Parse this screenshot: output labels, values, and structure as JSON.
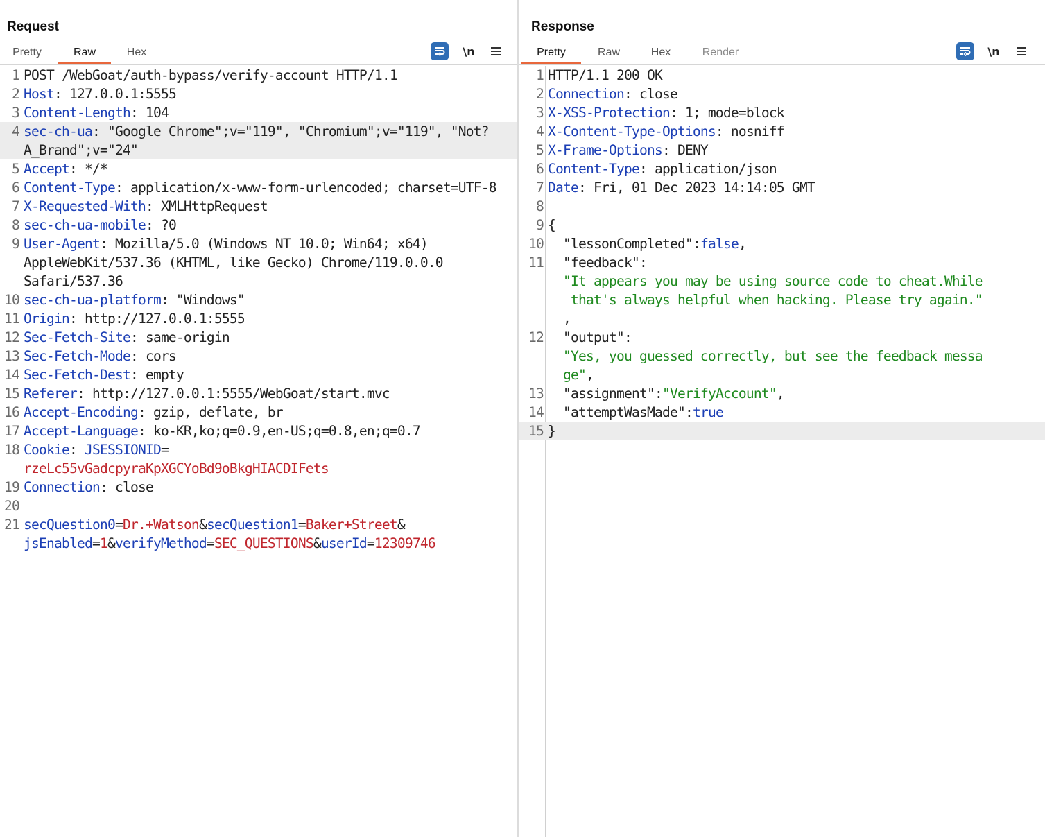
{
  "request": {
    "title": "Request",
    "tabs": [
      {
        "label": "Pretty",
        "active": false
      },
      {
        "label": "Raw",
        "active": true
      },
      {
        "label": "Hex",
        "active": false
      }
    ],
    "toolbar": {
      "wrap_icon": "text-wrap-icon",
      "newline_label": "\\n",
      "menu_icon": "hamburger-menu-icon"
    },
    "lines": [
      {
        "n": "1",
        "parts": [
          {
            "t": "POST /WebGoat/auth-bypass/verify-account HTTP/1.1",
            "c": "pl"
          }
        ]
      },
      {
        "n": "2",
        "parts": [
          {
            "t": "Host",
            "c": "hk"
          },
          {
            "t": ": 127.0.0.1:5555",
            "c": "hv"
          }
        ]
      },
      {
        "n": "3",
        "parts": [
          {
            "t": "Content-Length",
            "c": "hk"
          },
          {
            "t": ": 104",
            "c": "hv"
          }
        ]
      },
      {
        "n": "4",
        "highlight": true,
        "parts": [
          {
            "t": "sec-ch-ua",
            "c": "hk"
          },
          {
            "t": ": \"Google Chrome\";v=\"119\", \"Chromium\";v=\"119\", \"Not?A_Brand\";v=\"24\"",
            "c": "hv"
          }
        ]
      },
      {
        "n": "5",
        "parts": [
          {
            "t": "Accept",
            "c": "hk"
          },
          {
            "t": ": */*",
            "c": "hv"
          }
        ]
      },
      {
        "n": "6",
        "parts": [
          {
            "t": "Content-Type",
            "c": "hk"
          },
          {
            "t": ": application/x-www-form-urlencoded; charset=UTF-8",
            "c": "hv"
          }
        ]
      },
      {
        "n": "7",
        "parts": [
          {
            "t": "X-Requested-With",
            "c": "hk"
          },
          {
            "t": ": XMLHttpRequest",
            "c": "hv"
          }
        ]
      },
      {
        "n": "8",
        "parts": [
          {
            "t": "sec-ch-ua-mobile",
            "c": "hk"
          },
          {
            "t": ": ?0",
            "c": "hv"
          }
        ]
      },
      {
        "n": "9",
        "parts": [
          {
            "t": "User-Agent",
            "c": "hk"
          },
          {
            "t": ": Mozilla/5.0 (Windows NT 10.0; Win64; x64) AppleWebKit/537.36 (KHTML, like Gecko) Chrome/119.0.0.0 Safari/537.36",
            "c": "hv"
          }
        ]
      },
      {
        "n": "10",
        "parts": [
          {
            "t": "sec-ch-ua-platform",
            "c": "hk"
          },
          {
            "t": ": \"Windows\"",
            "c": "hv"
          }
        ]
      },
      {
        "n": "11",
        "parts": [
          {
            "t": "Origin",
            "c": "hk"
          },
          {
            "t": ": http://127.0.0.1:5555",
            "c": "hv"
          }
        ]
      },
      {
        "n": "12",
        "parts": [
          {
            "t": "Sec-Fetch-Site",
            "c": "hk"
          },
          {
            "t": ": same-origin",
            "c": "hv"
          }
        ]
      },
      {
        "n": "13",
        "parts": [
          {
            "t": "Sec-Fetch-Mode",
            "c": "hk"
          },
          {
            "t": ": cors",
            "c": "hv"
          }
        ]
      },
      {
        "n": "14",
        "parts": [
          {
            "t": "Sec-Fetch-Dest",
            "c": "hk"
          },
          {
            "t": ": empty",
            "c": "hv"
          }
        ]
      },
      {
        "n": "15",
        "parts": [
          {
            "t": "Referer",
            "c": "hk"
          },
          {
            "t": ": http://127.0.0.1:5555/WebGoat/start.mvc",
            "c": "hv"
          }
        ]
      },
      {
        "n": "16",
        "parts": [
          {
            "t": "Accept-Encoding",
            "c": "hk"
          },
          {
            "t": ": gzip, deflate, br",
            "c": "hv"
          }
        ]
      },
      {
        "n": "17",
        "parts": [
          {
            "t": "Accept-Language",
            "c": "hk"
          },
          {
            "t": ": ko-KR,ko;q=0.9,en-US;q=0.8,en;q=0.7",
            "c": "hv"
          }
        ]
      },
      {
        "n": "18",
        "parts": [
          {
            "t": "Cookie",
            "c": "hk"
          },
          {
            "t": ": ",
            "c": "hv"
          },
          {
            "t": "JSESSIONID",
            "c": "ck"
          },
          {
            "t": "=\n",
            "c": "hv"
          },
          {
            "t": "rzeLc55vGadcpyraKpXGCYoBd9oBkgHIACDIFets",
            "c": "cv"
          }
        ]
      },
      {
        "n": "19",
        "parts": [
          {
            "t": "Connection",
            "c": "hk"
          },
          {
            "t": ": close",
            "c": "hv"
          }
        ]
      },
      {
        "n": "20",
        "parts": [
          {
            "t": "",
            "c": "pl"
          }
        ]
      },
      {
        "n": "21",
        "parts": [
          {
            "t": "secQuestion0",
            "c": "pk"
          },
          {
            "t": "=",
            "c": "pl"
          },
          {
            "t": "Dr.+Watson",
            "c": "pv"
          },
          {
            "t": "&",
            "c": "pl"
          },
          {
            "t": "secQuestion1",
            "c": "pk"
          },
          {
            "t": "=",
            "c": "pl"
          },
          {
            "t": "Baker+Street",
            "c": "pv"
          },
          {
            "t": "&\n",
            "c": "pl"
          },
          {
            "t": "jsEnabled",
            "c": "pk"
          },
          {
            "t": "=",
            "c": "pl"
          },
          {
            "t": "1",
            "c": "pv"
          },
          {
            "t": "&",
            "c": "pl"
          },
          {
            "t": "verifyMethod",
            "c": "pk"
          },
          {
            "t": "=",
            "c": "pl"
          },
          {
            "t": "SEC_QUESTIONS",
            "c": "pv"
          },
          {
            "t": "&",
            "c": "pl"
          },
          {
            "t": "userId",
            "c": "pk"
          },
          {
            "t": "=",
            "c": "pl"
          },
          {
            "t": "12309746",
            "c": "pv"
          }
        ]
      }
    ]
  },
  "response": {
    "title": "Response",
    "tabs": [
      {
        "label": "Pretty",
        "active": true
      },
      {
        "label": "Raw",
        "active": false
      },
      {
        "label": "Hex",
        "active": false
      },
      {
        "label": "Render",
        "active": false,
        "disabled": true
      }
    ],
    "toolbar": {
      "wrap_icon": "text-wrap-icon",
      "newline_label": "\\n",
      "menu_icon": "hamburger-menu-icon"
    },
    "lines": [
      {
        "n": "1",
        "parts": [
          {
            "t": "HTTP/1.1 200 OK",
            "c": "pl"
          }
        ]
      },
      {
        "n": "2",
        "parts": [
          {
            "t": "Connection",
            "c": "hk"
          },
          {
            "t": ": close",
            "c": "hv"
          }
        ]
      },
      {
        "n": "3",
        "parts": [
          {
            "t": "X-XSS-Protection",
            "c": "hk"
          },
          {
            "t": ": 1; mode=block",
            "c": "hv"
          }
        ]
      },
      {
        "n": "4",
        "parts": [
          {
            "t": "X-Content-Type-Options",
            "c": "hk"
          },
          {
            "t": ": nosniff",
            "c": "hv"
          }
        ]
      },
      {
        "n": "5",
        "parts": [
          {
            "t": "X-Frame-Options",
            "c": "hk"
          },
          {
            "t": ": DENY",
            "c": "hv"
          }
        ]
      },
      {
        "n": "6",
        "parts": [
          {
            "t": "Content-Type",
            "c": "hk"
          },
          {
            "t": ": application/json",
            "c": "hv"
          }
        ]
      },
      {
        "n": "7",
        "parts": [
          {
            "t": "Date",
            "c": "hk"
          },
          {
            "t": ": Fri, 01 Dec 2023 14:14:05 GMT",
            "c": "hv"
          }
        ]
      },
      {
        "n": "8",
        "parts": [
          {
            "t": "",
            "c": "pl"
          }
        ]
      },
      {
        "n": "9",
        "parts": [
          {
            "t": "{",
            "c": "pl"
          }
        ]
      },
      {
        "n": "10",
        "parts": [
          {
            "t": "  \"lessonCompleted\"",
            "c": "jk"
          },
          {
            "t": ":",
            "c": "pl"
          },
          {
            "t": "false",
            "c": "jv"
          },
          {
            "t": ",",
            "c": "pl"
          }
        ]
      },
      {
        "n": "11",
        "parts": [
          {
            "t": "  \"feedback\"",
            "c": "jk"
          },
          {
            "t": ":\n  ",
            "c": "pl"
          },
          {
            "t": "\"It appears you may be using source code to cheat.While\n   that's always helpful when hacking. Please try again.\"",
            "c": "js"
          },
          {
            "t": "\n  ,",
            "c": "pl"
          }
        ]
      },
      {
        "n": "12",
        "parts": [
          {
            "t": "  \"output\"",
            "c": "jk"
          },
          {
            "t": ":\n  ",
            "c": "pl"
          },
          {
            "t": "\"Yes, you guessed correctly, but see the feedback messa\n  ge\"",
            "c": "js"
          },
          {
            "t": ",",
            "c": "pl"
          }
        ]
      },
      {
        "n": "13",
        "parts": [
          {
            "t": "  \"assignment\"",
            "c": "jk"
          },
          {
            "t": ":",
            "c": "pl"
          },
          {
            "t": "\"VerifyAccount\"",
            "c": "js"
          },
          {
            "t": ",",
            "c": "pl"
          }
        ]
      },
      {
        "n": "14",
        "parts": [
          {
            "t": "  \"attemptWasMade\"",
            "c": "jk"
          },
          {
            "t": ":",
            "c": "pl"
          },
          {
            "t": "true",
            "c": "jv"
          }
        ]
      },
      {
        "n": "15",
        "highlight": true,
        "parts": [
          {
            "t": "}",
            "c": "pl"
          }
        ]
      }
    ]
  },
  "layout_toggle": {
    "options": [
      "side-by-side-icon",
      "stacked-icon",
      "single-pane-icon"
    ],
    "active": "side-by-side-icon"
  },
  "colors": {
    "accent": "#2f6db5",
    "tab_underline": "#e8673c",
    "header_key": "#1c3fb5",
    "param_value": "#c0262d",
    "json_string": "#1f8a1f"
  }
}
